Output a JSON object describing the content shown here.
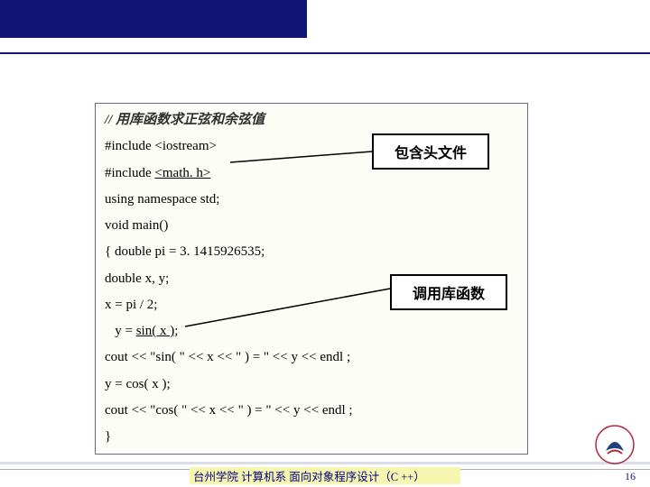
{
  "comment": "// 用库函数求正弦和余弦值",
  "lines": {
    "l1": "#include <iostream>",
    "l2": "#include <math. h>",
    "l3": "using namespace std;",
    "l4": "void main()",
    "l5": "{  double pi = 3. 1415926535;",
    "l6": "   double x, y;",
    "l7": "   x = pi / 2;",
    "l8": "   y = sin( x );",
    "l9": "   cout << \"sin( \" << x << \" ) = \" << y << endl ;",
    "l10": "   y = cos( x );",
    "l11": "   cout << \"cos( \" << x << \" ) = \" << y << endl ;",
    "l12": "}"
  },
  "callouts": {
    "c1": "包含头文件",
    "c2": "调用库函数"
  },
  "footer": "台州学院 计算机系 面向对象程序设计（C ++）",
  "page_number": "16"
}
